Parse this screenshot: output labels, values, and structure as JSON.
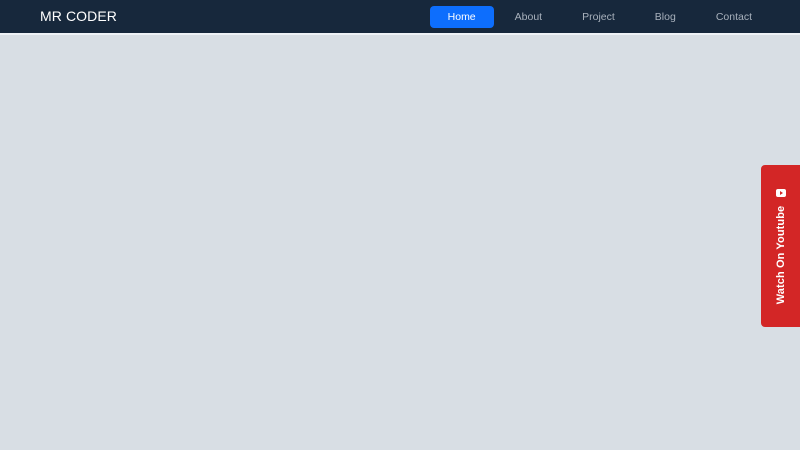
{
  "brand": {
    "name": "MR CODER"
  },
  "nav": {
    "items": [
      {
        "label": "Home",
        "active": true
      },
      {
        "label": "About",
        "active": false
      },
      {
        "label": "Project",
        "active": false
      },
      {
        "label": "Blog",
        "active": false
      },
      {
        "label": "Contact",
        "active": false
      }
    ]
  },
  "floating_tab": {
    "label": "Watch On Youtube",
    "icon": "youtube-play-icon"
  },
  "colors": {
    "navbar_bg": "#17283c",
    "page_bg": "#d8dee4",
    "active_nav": "#0d6efd",
    "youtube_red": "#d32626"
  }
}
